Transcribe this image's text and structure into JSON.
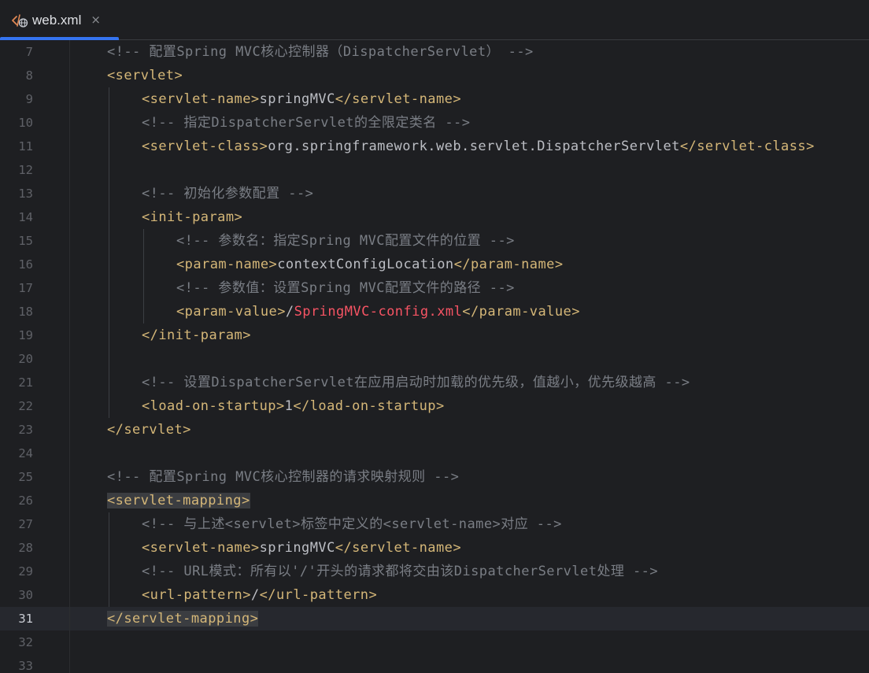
{
  "tab": {
    "filename": "web.xml",
    "close_glyph": "×",
    "icon": "xml-file-icon"
  },
  "colors": {
    "background": "#1e1f22",
    "tag": "#d5b778",
    "comment": "#7a7e85",
    "text": "#bcbec4",
    "error": "#f75464",
    "accent": "#3574f0"
  },
  "editor": {
    "current_line": "31",
    "lines": [
      {
        "n": "7",
        "indent": 1,
        "tokens": [
          {
            "t": "comment",
            "v": "<!-- 配置Spring MVC核心控制器（DispatcherServlet） -->"
          }
        ]
      },
      {
        "n": "8",
        "indent": 1,
        "tokens": [
          {
            "t": "tag",
            "v": "<servlet>"
          }
        ]
      },
      {
        "n": "9",
        "indent": 2,
        "tokens": [
          {
            "t": "tag",
            "v": "<servlet-name>"
          },
          {
            "t": "text",
            "v": "springMVC"
          },
          {
            "t": "tag",
            "v": "</servlet-name>"
          }
        ]
      },
      {
        "n": "10",
        "indent": 2,
        "tokens": [
          {
            "t": "comment",
            "v": "<!-- 指定DispatcherServlet的全限定类名 -->"
          }
        ]
      },
      {
        "n": "11",
        "indent": 2,
        "tokens": [
          {
            "t": "tag",
            "v": "<servlet-class>"
          },
          {
            "t": "text",
            "v": "org.springframework.web.servlet.DispatcherServlet"
          },
          {
            "t": "tag",
            "v": "</servlet-class>"
          }
        ]
      },
      {
        "n": "12",
        "indent": 0,
        "tokens": []
      },
      {
        "n": "13",
        "indent": 2,
        "tokens": [
          {
            "t": "comment",
            "v": "<!-- 初始化参数配置 -->"
          }
        ]
      },
      {
        "n": "14",
        "indent": 2,
        "tokens": [
          {
            "t": "tag",
            "v": "<init-param>"
          }
        ]
      },
      {
        "n": "15",
        "indent": 3,
        "tokens": [
          {
            "t": "comment",
            "v": "<!-- 参数名：指定Spring MVC配置文件的位置 -->"
          }
        ]
      },
      {
        "n": "16",
        "indent": 3,
        "tokens": [
          {
            "t": "tag",
            "v": "<param-name>"
          },
          {
            "t": "text",
            "v": "contextConfigLocation"
          },
          {
            "t": "tag",
            "v": "</param-name>"
          }
        ]
      },
      {
        "n": "17",
        "indent": 3,
        "tokens": [
          {
            "t": "comment",
            "v": "<!-- 参数值：设置Spring MVC配置文件的路径 -->"
          }
        ]
      },
      {
        "n": "18",
        "indent": 3,
        "tokens": [
          {
            "t": "tag",
            "v": "<param-value>"
          },
          {
            "t": "text",
            "v": "/"
          },
          {
            "t": "error",
            "v": "SpringMVC-config.xml"
          },
          {
            "t": "tag",
            "v": "</param-value>"
          }
        ]
      },
      {
        "n": "19",
        "indent": 2,
        "tokens": [
          {
            "t": "tag",
            "v": "</init-param>"
          }
        ]
      },
      {
        "n": "20",
        "indent": 0,
        "tokens": []
      },
      {
        "n": "21",
        "indent": 2,
        "tokens": [
          {
            "t": "comment",
            "v": "<!-- 设置DispatcherServlet在应用启动时加载的优先级，值越小，优先级越高 -->"
          }
        ]
      },
      {
        "n": "22",
        "indent": 2,
        "tokens": [
          {
            "t": "tag",
            "v": "<load-on-startup>"
          },
          {
            "t": "text",
            "v": "1"
          },
          {
            "t": "tag",
            "v": "</load-on-startup>"
          }
        ]
      },
      {
        "n": "23",
        "indent": 1,
        "tokens": [
          {
            "t": "tag",
            "v": "</servlet>"
          }
        ]
      },
      {
        "n": "24",
        "indent": 0,
        "tokens": []
      },
      {
        "n": "25",
        "indent": 1,
        "tokens": [
          {
            "t": "comment",
            "v": "<!-- 配置Spring MVC核心控制器的请求映射规则 -->"
          }
        ]
      },
      {
        "n": "26",
        "indent": 1,
        "tokens": [
          {
            "t": "tag",
            "v": "<servlet-mapping>",
            "hl": true
          }
        ]
      },
      {
        "n": "27",
        "indent": 2,
        "tokens": [
          {
            "t": "comment",
            "v": "<!-- 与上述<servlet>标签中定义的<servlet-name>对应 -->"
          }
        ]
      },
      {
        "n": "28",
        "indent": 2,
        "tokens": [
          {
            "t": "tag",
            "v": "<servlet-name>"
          },
          {
            "t": "text",
            "v": "springMVC"
          },
          {
            "t": "tag",
            "v": "</servlet-name>"
          }
        ]
      },
      {
        "n": "29",
        "indent": 2,
        "tokens": [
          {
            "t": "comment",
            "v": "<!-- URL模式：所有以'/'开头的请求都将交由该DispatcherServlet处理 -->"
          }
        ]
      },
      {
        "n": "30",
        "indent": 2,
        "tokens": [
          {
            "t": "tag",
            "v": "<url-pattern>"
          },
          {
            "t": "text",
            "v": "/"
          },
          {
            "t": "tag",
            "v": "</url-pattern>"
          }
        ]
      },
      {
        "n": "31",
        "indent": 1,
        "tokens": [
          {
            "t": "tag",
            "v": "</servlet-mapping>",
            "hl": true
          }
        ]
      },
      {
        "n": "32",
        "indent": 0,
        "tokens": []
      },
      {
        "n": "33",
        "indent": 0,
        "tokens": []
      }
    ]
  }
}
